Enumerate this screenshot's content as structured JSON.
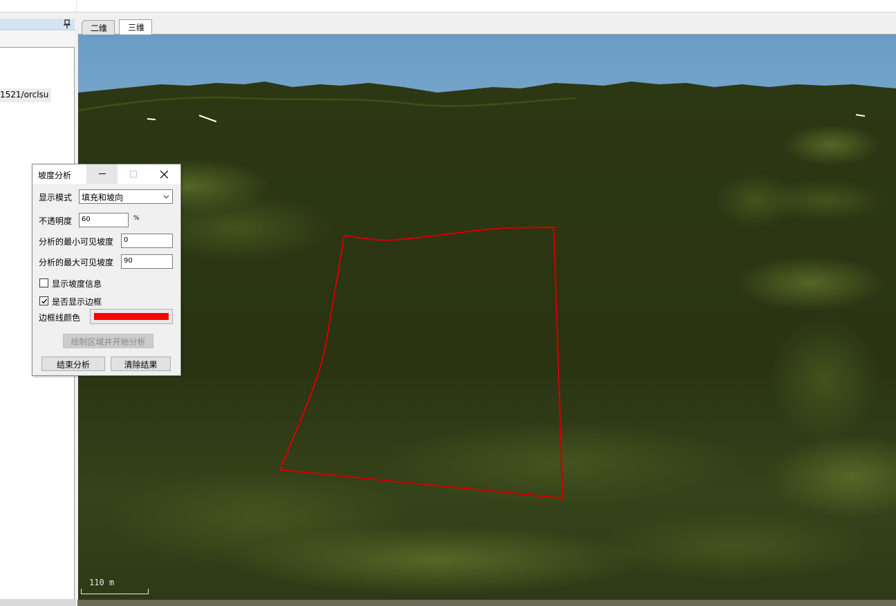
{
  "view_tabs": [
    {
      "label": "二维"
    },
    {
      "label": "三维"
    }
  ],
  "left_panel": {
    "tree_item": "1521/orclsu"
  },
  "scene": {
    "scale_label": "110 m",
    "sky_color_top": "#6f9fc6",
    "terrain_color": "#2b3514",
    "boundary_color": "#cc0000"
  },
  "dialog": {
    "title": "坡度分析",
    "display_mode_label": "显示模式",
    "display_mode_value": "填充和坡向",
    "opacity_label": "不透明度",
    "opacity_value": "60",
    "opacity_unit": "%",
    "min_slope_label": "分析的最小可见坡度",
    "min_slope_value": "0",
    "max_slope_label": "分析的最大可见坡度",
    "max_slope_value": "90",
    "show_slope_info_label": "显示坡度信息",
    "show_slope_info_checked": false,
    "show_border_label": "是否显示边框",
    "show_border_checked": true,
    "border_color_label": "边框线颜色",
    "border_color": "#ff0000",
    "draw_button": "绘制区域并开始分析",
    "end_button": "结束分析",
    "clear_button": "清除结果"
  }
}
